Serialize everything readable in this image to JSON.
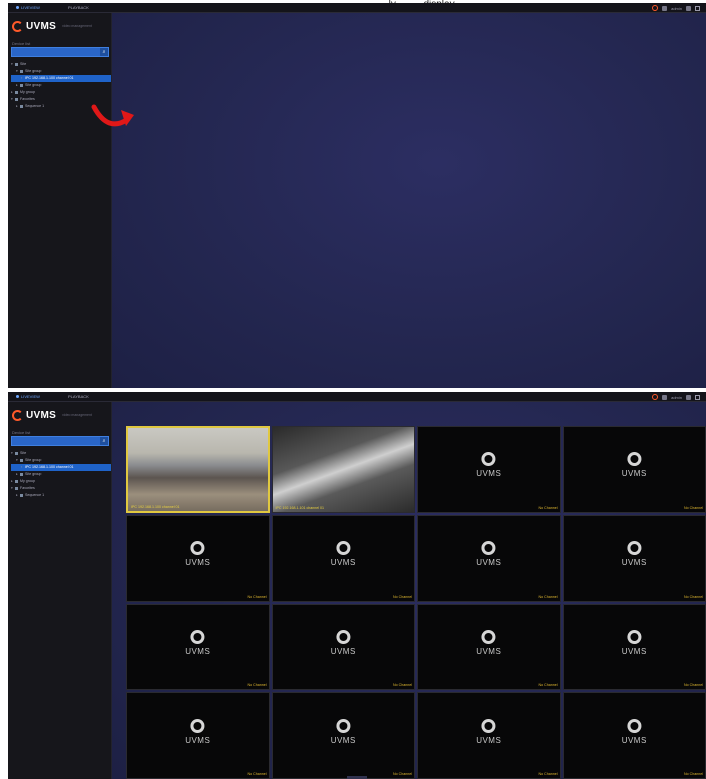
{
  "caption": "…ly, … …display …",
  "window": {
    "tabs": [
      {
        "label": "LIVEVIEW"
      },
      {
        "label": "PLAYBACK"
      }
    ],
    "tray_text": "admin"
  },
  "sidebar": {
    "logo_text": "UVMS",
    "logo_sub": "video management",
    "search_label": "Device list",
    "search_placeholder": "",
    "tree": [
      {
        "label": "Site",
        "level": 0,
        "selected": false
      },
      {
        "label": "Site group",
        "level": 1,
        "selected": false
      },
      {
        "label": "IPC 192.168.1.100 channel 01",
        "level": 2,
        "selected": true
      },
      {
        "label": "Site group",
        "level": 1,
        "selected": false
      },
      {
        "label": "My group",
        "level": 0,
        "selected": false
      },
      {
        "label": "Favorites",
        "level": 0,
        "selected": false
      },
      {
        "label": "Sequence 1",
        "level": 1,
        "selected": false
      }
    ]
  },
  "grid": {
    "tiles": [
      {
        "type": "camera",
        "label": "IPC 192.168.1.100 channel 01",
        "scene": "office",
        "active": true
      },
      {
        "type": "camera",
        "label": "IPC 192.168.1.101 channel 01",
        "scene": "hallway",
        "active": false
      },
      {
        "type": "empty",
        "brand": "UVMS",
        "status": "No Channel"
      },
      {
        "type": "empty",
        "brand": "UVMS",
        "status": "No Channel"
      },
      {
        "type": "empty",
        "brand": "UVMS",
        "status": "No Channel"
      },
      {
        "type": "empty",
        "brand": "UVMS",
        "status": "No Channel"
      },
      {
        "type": "empty",
        "brand": "UVMS",
        "status": "No Channel"
      },
      {
        "type": "empty",
        "brand": "UVMS",
        "status": "No Channel"
      },
      {
        "type": "empty",
        "brand": "UVMS",
        "status": "No Channel"
      },
      {
        "type": "empty",
        "brand": "UVMS",
        "status": "No Channel"
      },
      {
        "type": "empty",
        "brand": "UVMS",
        "status": "No Channel"
      },
      {
        "type": "empty",
        "brand": "UVMS",
        "status": "No Channel"
      },
      {
        "type": "empty",
        "brand": "UVMS",
        "status": "No Channel"
      },
      {
        "type": "empty",
        "brand": "UVMS",
        "status": "No Channel"
      },
      {
        "type": "empty",
        "brand": "UVMS",
        "status": "No Channel"
      },
      {
        "type": "empty",
        "brand": "UVMS",
        "status": "No Channel"
      }
    ]
  },
  "colors": {
    "accent_orange": "#ff5a2a",
    "selection_blue": "#1f63c9",
    "viewport_bg": "#23264f",
    "active_tile_border": "#e0c840",
    "no_channel_text": "#e0b830",
    "drag_arrow": "#e01818"
  },
  "icons": {
    "drag_arrow": "curved-arrow-icon",
    "record": "record-icon",
    "logo": "uvms-logo-icon"
  }
}
